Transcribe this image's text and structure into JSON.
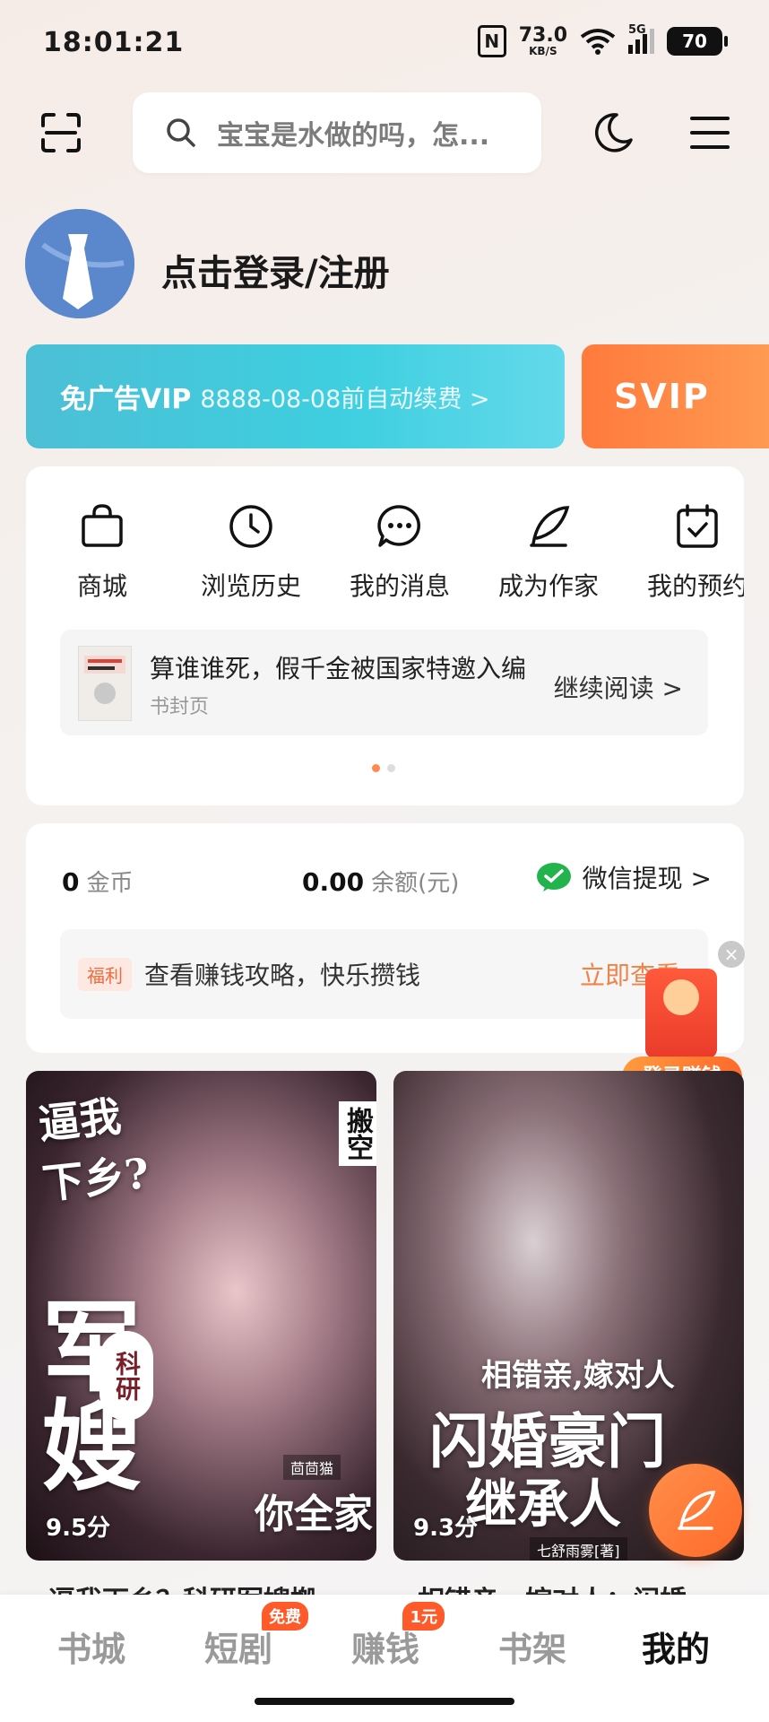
{
  "status_bar": {
    "time": "18:01:21",
    "nfc": "N",
    "net_speed": "73.0",
    "net_unit": "KB/S",
    "network": "5G",
    "battery": "70"
  },
  "search": {
    "placeholder": "宝宝是水做的吗，怎..."
  },
  "profile": {
    "login_text": "点击登录/注册"
  },
  "vip": {
    "title": "免广告VIP",
    "subtitle": "8888-08-08前自动续费 >",
    "svip": "SVIP"
  },
  "features": [
    {
      "label": "商城"
    },
    {
      "label": "浏览历史"
    },
    {
      "label": "我的消息"
    },
    {
      "label": "成为作家"
    },
    {
      "label": "我的预约"
    }
  ],
  "reading": {
    "title": "算谁谁死，假千金被国家特邀入编",
    "subtitle": "书封页",
    "action": "继续阅读 >"
  },
  "wallet": {
    "coins_value": "0",
    "coins_label": "金币",
    "balance_value": "0.00",
    "balance_label": "余额(元)",
    "withdraw": "微信提现 >",
    "welfare_badge": "福利",
    "welfare_text": "查看赚钱攻略，快乐攒钱",
    "welfare_link": "立即查看"
  },
  "float": {
    "login_earn": "登录赚钱",
    "close": "×"
  },
  "books": [
    {
      "cover_line1": "逼我",
      "cover_line2": "下乡?",
      "cover_big": "军嫂",
      "cover_tag": "科研",
      "cover_side": "搬空",
      "cover_bottom": "你全家",
      "author": "茴茴猫",
      "score": "9.5分",
      "title_peek": "逼我下乡？科研军嫂搬"
    },
    {
      "cover_line1": "相错亲,嫁对人",
      "cover_big": "闪婚豪门",
      "cover_bottom": "继承人",
      "author": "七舒雨雾[著]",
      "score": "9.3分",
      "title_peek": "相错亲，嫁对人：闪婚"
    }
  ],
  "bottom_nav": [
    {
      "label": "书城"
    },
    {
      "label": "短剧",
      "badge": "免费"
    },
    {
      "label": "赚钱",
      "badge": "1元"
    },
    {
      "label": "书架"
    },
    {
      "label": "我的"
    }
  ]
}
